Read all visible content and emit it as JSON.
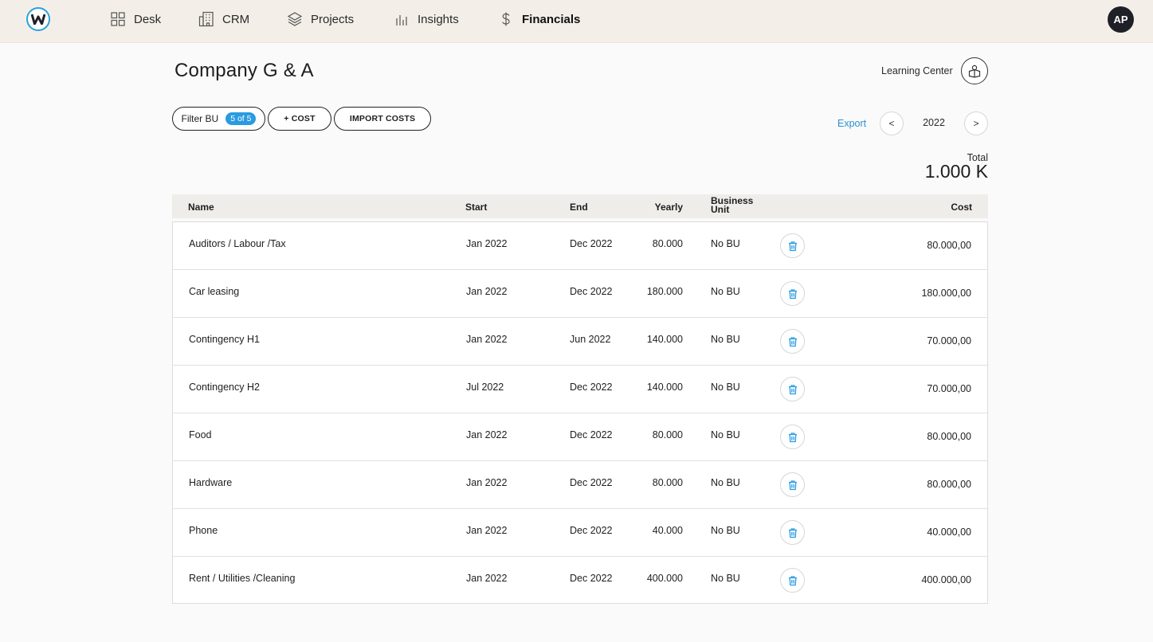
{
  "nav": {
    "logo_icon": "w-logo-icon",
    "items": [
      {
        "label": "Desk",
        "icon": "grid-icon"
      },
      {
        "label": "CRM",
        "icon": "building-icon"
      },
      {
        "label": "Projects",
        "icon": "layers-icon"
      },
      {
        "label": "Insights",
        "icon": "bar-chart-icon"
      },
      {
        "label": "Financials",
        "icon": "dollar-icon",
        "active": true
      }
    ],
    "avatar": "AP"
  },
  "header": {
    "title": "Company G & A",
    "learning_center": "Learning Center"
  },
  "toolbar": {
    "filter_label": "Filter BU",
    "filter_badge": "5 of 5",
    "add_cost": "+ COST",
    "import_costs": "IMPORT COSTS",
    "export": "Export",
    "prev": "<",
    "year": "2022",
    "next": ">"
  },
  "summary": {
    "total_label": "Total",
    "total_value": "1.000 K"
  },
  "table": {
    "headers": {
      "name": "Name",
      "start": "Start",
      "end": "End",
      "yearly": "Yearly",
      "bu_line1": "Business",
      "bu_line2": "Unit",
      "cost": "Cost"
    },
    "rows": [
      {
        "name": "Auditors / Labour /Tax",
        "start": "Jan 2022",
        "end": "Dec 2022",
        "yearly": "80.000",
        "bu": "No BU",
        "cost": "80.000,00"
      },
      {
        "name": "Car leasing",
        "start": "Jan 2022",
        "end": "Dec 2022",
        "yearly": "180.000",
        "bu": "No BU",
        "cost": "180.000,00"
      },
      {
        "name": "Contingency H1",
        "start": "Jan 2022",
        "end": "Jun 2022",
        "yearly": "140.000",
        "bu": "No BU",
        "cost": "70.000,00"
      },
      {
        "name": "Contingency H2",
        "start": "Jul 2022",
        "end": "Dec 2022",
        "yearly": "140.000",
        "bu": "No BU",
        "cost": "70.000,00"
      },
      {
        "name": "Food",
        "start": "Jan 2022",
        "end": "Dec 2022",
        "yearly": "80.000",
        "bu": "No BU",
        "cost": "80.000,00"
      },
      {
        "name": "Hardware",
        "start": "Jan 2022",
        "end": "Dec 2022",
        "yearly": "80.000",
        "bu": "No BU",
        "cost": "80.000,00"
      },
      {
        "name": "Phone",
        "start": "Jan 2022",
        "end": "Dec 2022",
        "yearly": "40.000",
        "bu": "No BU",
        "cost": "40.000,00"
      },
      {
        "name": "Rent / Utilities /Cleaning",
        "start": "Jan 2022",
        "end": "Dec 2022",
        "yearly": "400.000",
        "bu": "No BU",
        "cost": "400.000,00"
      }
    ]
  },
  "colors": {
    "accent": "#2b9be0",
    "topbar": "#f3efe8",
    "avatar": "#1f2027"
  }
}
